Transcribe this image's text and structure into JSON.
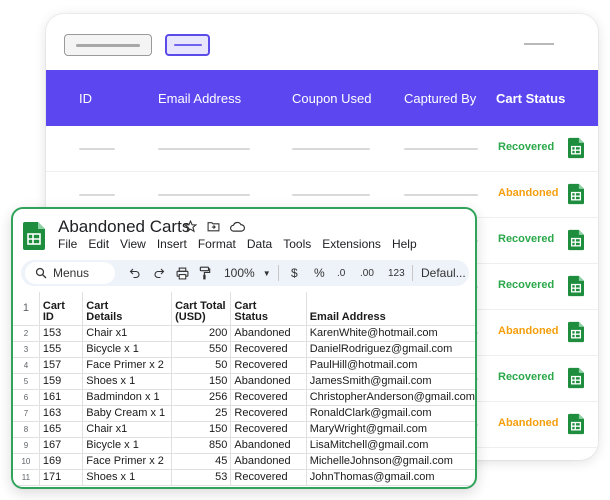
{
  "dashboard": {
    "headers": {
      "id": "ID",
      "email": "Email Address",
      "coupon": "Coupon Used",
      "captured": "Captured By",
      "status": "Cart Status"
    },
    "rows": [
      {
        "status": "Recovered",
        "kind": "recovered"
      },
      {
        "status": "Abandoned",
        "kind": "abandoned"
      },
      {
        "status": "Recovered",
        "kind": "recovered"
      },
      {
        "status": "Recovered",
        "kind": "recovered"
      },
      {
        "status": "Abandoned",
        "kind": "abandoned"
      },
      {
        "status": "Recovered",
        "kind": "recovered"
      },
      {
        "status": "Abandoned",
        "kind": "abandoned"
      }
    ]
  },
  "sheet": {
    "title": "Abandoned Carts",
    "title_icons": [
      "star-icon",
      "folder-move-icon",
      "cloud-status-icon"
    ],
    "menu": [
      "File",
      "Edit",
      "View",
      "Insert",
      "Format",
      "Data",
      "Tools",
      "Extensions",
      "Help"
    ],
    "toolbar": {
      "search_label": "Menus",
      "zoom": "100%",
      "currency": "$",
      "percent": "%",
      "dec_less": ".0",
      "dec_more": ".00",
      "number_format": "123",
      "font": "Defaul..."
    },
    "header_row_number": "1",
    "columns": [
      [
        "Cart",
        "ID"
      ],
      [
        "Cart",
        "Details"
      ],
      [
        "Cart Total",
        "(USD)"
      ],
      [
        "Cart",
        "Status"
      ],
      [
        "",
        "Email Address"
      ]
    ],
    "rows": [
      {
        "n": "2",
        "id": "153",
        "details": "Chair x1",
        "total": "200",
        "status": "Abandoned",
        "email": "KarenWhite@hotmail.com"
      },
      {
        "n": "3",
        "id": "155",
        "details": "Bicycle x 1",
        "total": "550",
        "status": "Recovered",
        "email": "DanielRodriguez@gmail.com"
      },
      {
        "n": "4",
        "id": "157",
        "details": "Face Primer x 2",
        "total": "50",
        "status": "Recovered",
        "email": "PaulHill@hotmail.com"
      },
      {
        "n": "5",
        "id": "159",
        "details": "Shoes x 1",
        "total": "150",
        "status": "Abandoned",
        "email": "JamesSmith@gmail.com"
      },
      {
        "n": "6",
        "id": "161",
        "details": "Badmindon x 1",
        "total": "256",
        "status": "Recovered",
        "email": "ChristopherAnderson@gmail.com"
      },
      {
        "n": "7",
        "id": "163",
        "details": "Baby Cream x 1",
        "total": "25",
        "status": "Recovered",
        "email": "RonaldClark@gmail.com"
      },
      {
        "n": "8",
        "id": "165",
        "details": "Chair x1",
        "total": "150",
        "status": "Recovered",
        "email": "MaryWright@gmail.com"
      },
      {
        "n": "9",
        "id": "167",
        "details": "Bicycle x 1",
        "total": "850",
        "status": "Abandoned",
        "email": "LisaMitchell@gmail.com"
      },
      {
        "n": "10",
        "id": "169",
        "details": "Face Primer x 2",
        "total": "45",
        "status": "Abandoned",
        "email": "MichelleJohnson@gmail.com"
      },
      {
        "n": "11",
        "id": "171",
        "details": "Shoes x 1",
        "total": "53",
        "status": "Recovered",
        "email": "JohnThomas@gmail.com"
      }
    ]
  },
  "colors": {
    "header_purple": "#5b46f0",
    "recovered_green": "#2aa84a",
    "abandoned_orange": "#f59e0b",
    "sheets_green": "#1e8e3e"
  }
}
